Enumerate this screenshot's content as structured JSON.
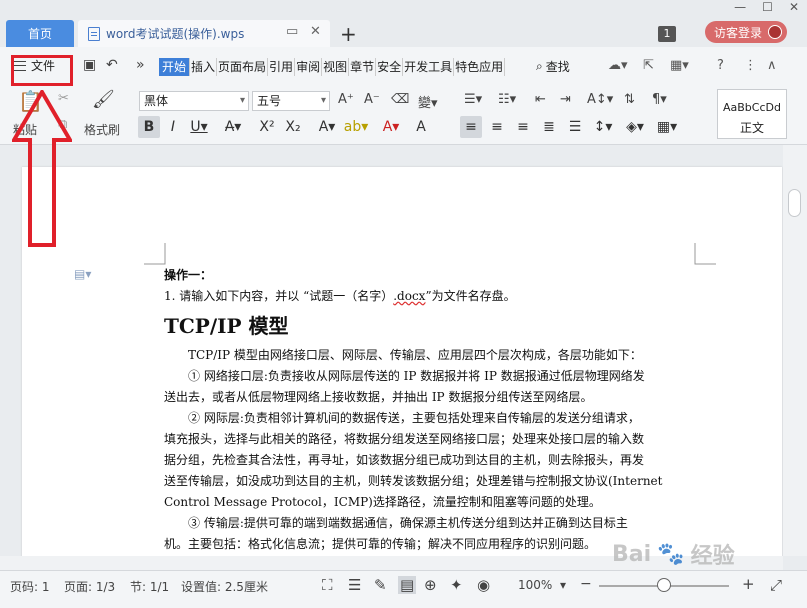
{
  "titlebar": {
    "home_tab": "首页",
    "doc_tab": "word考试试题(操作).wps",
    "new_tab": "+",
    "badge": "1",
    "login": "访客登录"
  },
  "menu": {
    "file": "文件",
    "tabs": [
      "开始",
      "插入",
      "页面布局",
      "引用",
      "审阅",
      "视图",
      "章节",
      "安全",
      "开发工具",
      "特色应用"
    ],
    "search": "查找"
  },
  "toolbar": {
    "paste": "粘贴",
    "format_painter": "格式刷",
    "font_name": "黑体",
    "font_size": "五号",
    "style_preview": "AaBbCcDd",
    "style_name": "正文"
  },
  "document": {
    "op_title": "操作一：",
    "instruction_prefix": "1. 请输入如下内容，并以 “试题一（名字）",
    "instruction_ext": ".docx",
    "instruction_suffix": "”为文件名存盘。",
    "heading": "TCP/IP 模型",
    "lines": [
      "TCP/IP 模型由网络接口层、网际层、传输层、应用层四个层次构成，各层功能如下：",
      "① 网络接口层:负责接收从网际层传送的 IP 数据报并将 IP 数据报通过低层物理网络发",
      "送出去，或者从低层物理网络上接收数据，并抽出 IP 数据报分组传送至网络层。",
      "② 网际层:负责相邻计算机间的数据传送，主要包括处理来自传输层的发送分组请求，",
      "填充报头，选择与此相关的路径，将数据分组发送至网络接口层；处理来处接口层的输入数",
      "据分组，先检查其合法性，再寻址，如该数据分组已成功到达目的主机，则去除报头，再发",
      "送至传输层，如没成功到达目的主机，则转发该数据分组；处理差错与控制报文协议(Internet",
      "Control Message Protocol，ICMP)选择路径，流量控制和阻塞等问题的处理。",
      "③ 传输层:提供可靠的端到端数据通信，确保源主机传送分组到达并正确到达目标主",
      "机。主要包括：格式化信息流；提供可靠的传输；解决不同应用程序的识别问题。"
    ]
  },
  "status": {
    "page_num": "页码: 1",
    "pages": "页面: 1/3",
    "section": "节: 1/1",
    "setting": "设置值: 2.5厘米",
    "zoom": "100%",
    "zoom_minus": "−",
    "zoom_plus": "+"
  },
  "watermark": {
    "text": "Bai",
    "text2": "经验"
  },
  "colors": {
    "accent": "#3d7fd8",
    "home_tab": "#4a8ce0",
    "login": "#d86a6a",
    "annotation": "#e0202a"
  }
}
